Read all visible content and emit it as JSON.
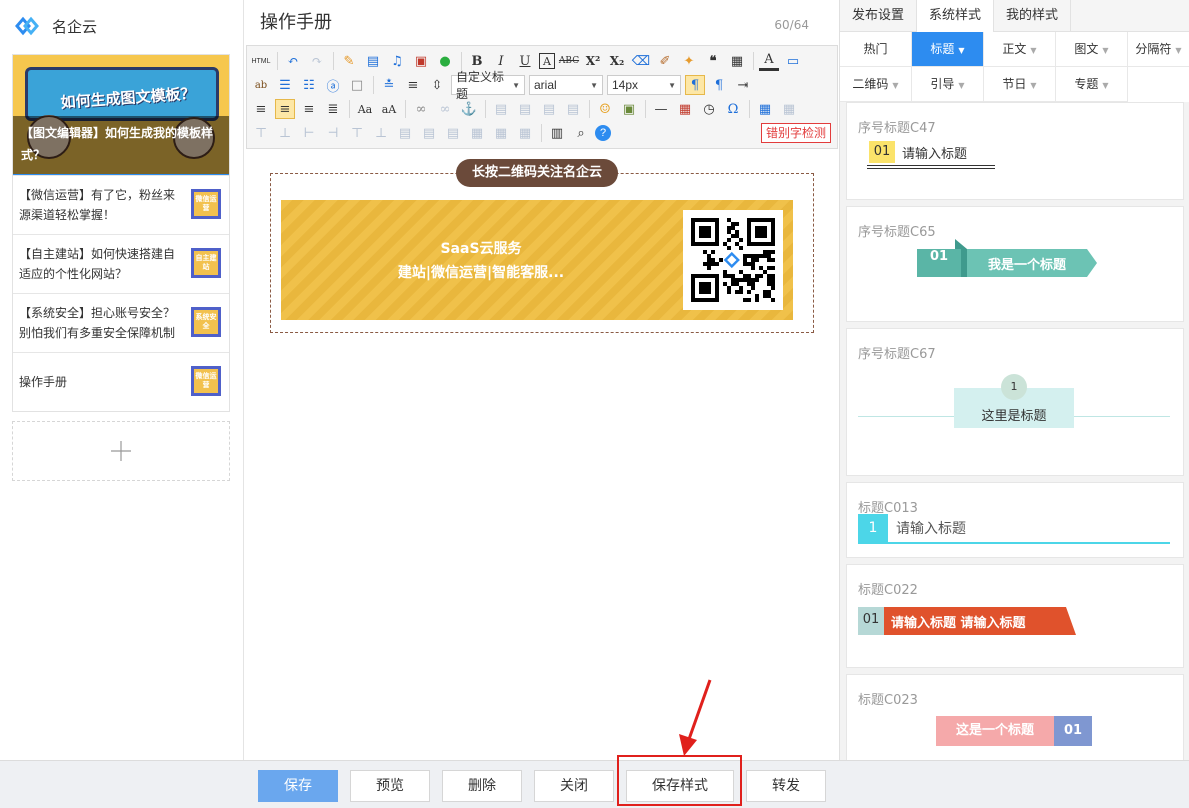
{
  "brand": {
    "name": "名企云"
  },
  "left": {
    "cover": {
      "title": "如何生成图文模板？",
      "caption": "【图文编辑器】如何生成我的模板样式？"
    },
    "articles": [
      {
        "title": "【微信运营】有了它，粉丝来源渠道轻松掌握！",
        "thumb": "微信运营"
      },
      {
        "title": "【自主建站】如何快速搭建自适应的个性化网站？",
        "thumb": "自主建站"
      },
      {
        "title": "【系统安全】担心账号安全？别怕我们有多重安全保障机制",
        "thumb": "系统安全"
      },
      {
        "title": "操作手册",
        "thumb": "微信运营"
      }
    ]
  },
  "editor": {
    "title": "操作手册",
    "count": "60/64",
    "toolbar": {
      "html": "HTML",
      "custom_title": "自定义标题",
      "font_family": "arial",
      "font_size": "14px",
      "error_check": "错别字检测"
    },
    "content": {
      "banner": "长按二维码关注名企云",
      "line1": "SaaS云服务",
      "line2": "建站|微信运营|智能客服..."
    }
  },
  "right": {
    "tabs": [
      "发布设置",
      "系统样式",
      "我的样式"
    ],
    "active_tab": "系统样式",
    "categories": [
      "热门",
      "标题",
      "正文",
      "图文",
      "分隔符",
      "二维码",
      "引导",
      "节日",
      "专题"
    ],
    "selected_category": "标题",
    "templates": [
      {
        "name": "序号标题C47",
        "num": "01",
        "text": "请输入标题"
      },
      {
        "name": "序号标题C65",
        "num": "01",
        "text": "我是一个标题"
      },
      {
        "name": "序号标题C67",
        "num": "1",
        "text": "这里是标题"
      },
      {
        "name": "标题C013",
        "num": "1",
        "text": "请输入标题"
      },
      {
        "name": "标题C022",
        "num": "01",
        "text": "请输入标题 请输入标题"
      },
      {
        "name": "标题C023",
        "num": "01",
        "text": "这是一个标题"
      }
    ]
  },
  "bottom": {
    "save": "保存",
    "preview": "预览",
    "delete": "删除",
    "close": "关闭",
    "save_style": "保存样式",
    "forward": "转发"
  },
  "colors": {
    "primary": "#2d8cf0",
    "highlight": "#e0201c",
    "banner": "#6b4a3a",
    "card": "#f0c14a"
  }
}
